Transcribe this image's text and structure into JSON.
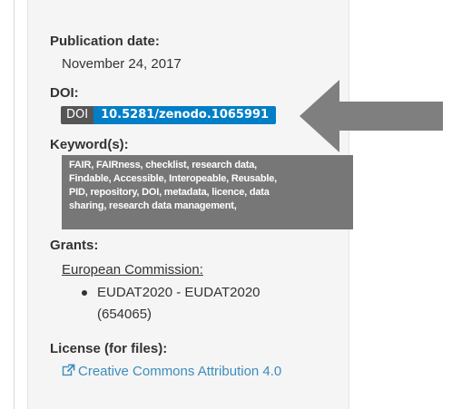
{
  "publication": {
    "label": "Publication date:",
    "value": "November 24, 2017"
  },
  "doi": {
    "label": "DOI:",
    "badge_left": "DOI",
    "badge_value": "10.5281/zenodo.1065991"
  },
  "keywords": {
    "label": "Keyword(s):",
    "lines": [
      "FAIR, FAIRness, checklist, research data,",
      "Findable, Accessible, Interopeable, Reusable,",
      "PID, repository, DOI, metadata, licence, data",
      "sharing, research data management,"
    ]
  },
  "grants": {
    "label": "Grants:",
    "funder": "European Commission:",
    "item_line1": "EUDAT2020 - EUDAT2020",
    "item_line2": "(654065)"
  },
  "license": {
    "label": "License (for files):",
    "link": "Creative Commons Attribution 4.0"
  },
  "colors": {
    "doi_badge_left": "#555555",
    "doi_badge_right": "#007ec6",
    "keywords_bg": "#777777",
    "link": "#3c8dbc",
    "arrow": "#7f7f7f"
  },
  "icons": {
    "license_link": "external-link-icon",
    "annotation": "arrow-left-icon"
  }
}
